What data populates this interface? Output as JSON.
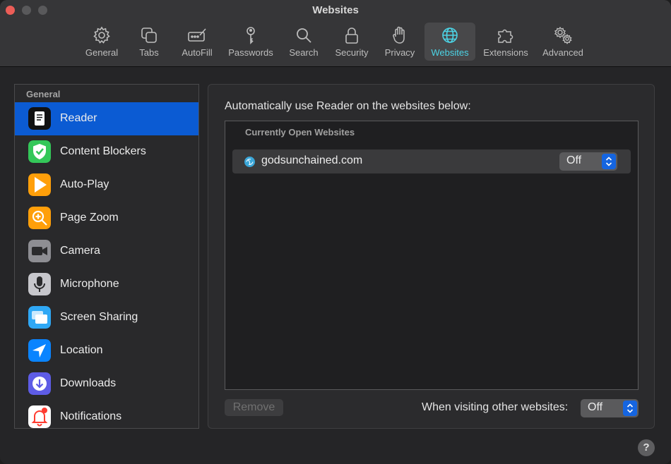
{
  "window": {
    "title": "Websites"
  },
  "toolbar": {
    "items": [
      {
        "label": "General",
        "icon": "gear-icon"
      },
      {
        "label": "Tabs",
        "icon": "tabs-icon"
      },
      {
        "label": "AutoFill",
        "icon": "autofill-icon"
      },
      {
        "label": "Passwords",
        "icon": "key-icon"
      },
      {
        "label": "Search",
        "icon": "search-icon"
      },
      {
        "label": "Security",
        "icon": "lock-icon"
      },
      {
        "label": "Privacy",
        "icon": "hand-icon"
      },
      {
        "label": "Websites",
        "icon": "globe-icon",
        "selected": true
      },
      {
        "label": "Extensions",
        "icon": "puzzle-icon"
      },
      {
        "label": "Advanced",
        "icon": "gears-icon"
      }
    ]
  },
  "sidebar": {
    "heading": "General",
    "items": [
      {
        "label": "Reader",
        "icon": "reader-icon",
        "color": "#1c1c1e",
        "selected": true
      },
      {
        "label": "Content Blockers",
        "icon": "shield-check-icon",
        "color": "#34c759"
      },
      {
        "label": "Auto-Play",
        "icon": "play-icon",
        "color": "#ff9f0a"
      },
      {
        "label": "Page Zoom",
        "icon": "zoom-icon",
        "color": "#ff9f0a"
      },
      {
        "label": "Camera",
        "icon": "camera-icon",
        "color": "#8e8e93"
      },
      {
        "label": "Microphone",
        "icon": "microphone-icon",
        "color": "#c7c7cc"
      },
      {
        "label": "Screen Sharing",
        "icon": "screen-sharing-icon",
        "color": "#2fa8f5"
      },
      {
        "label": "Location",
        "icon": "location-icon",
        "color": "#0a84ff"
      },
      {
        "label": "Downloads",
        "icon": "download-icon",
        "color": "#5e5ce6"
      },
      {
        "label": "Notifications",
        "icon": "bell-icon",
        "color": "#ffffff"
      }
    ]
  },
  "main": {
    "title": "Automatically use Reader on the websites below:",
    "list_header": "Currently Open Websites",
    "rows": [
      {
        "site": "godsunchained.com",
        "setting": "Off"
      }
    ],
    "remove_label": "Remove",
    "other_label": "When visiting other websites:",
    "other_value": "Off"
  },
  "help_label": "?",
  "colors": {
    "accent": "#4cd4e6",
    "selection": "#0b5bd3",
    "popup_arrow": "#1565e0"
  }
}
